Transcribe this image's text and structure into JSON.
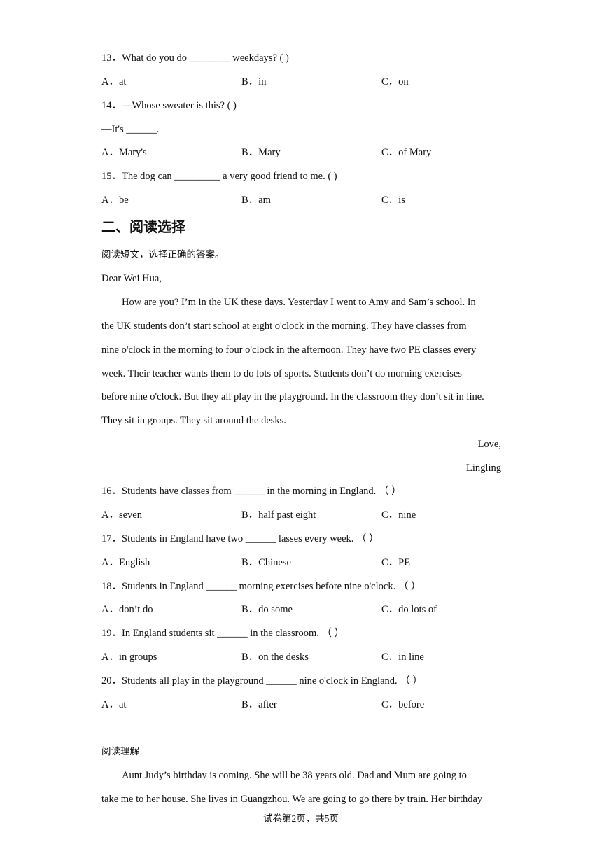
{
  "questions_part1": [
    {
      "number": "13．",
      "prompt": "What do you do ________ weekdays? (    )",
      "options": [
        "A．at",
        "B．in",
        "C．on"
      ]
    },
    {
      "number": "14．",
      "prompt": "—Whose sweater is this? (    )",
      "subline": "—It's ______.",
      "options": [
        "A．Mary's",
        "B．Mary",
        "C．of Mary"
      ]
    },
    {
      "number": "15．",
      "prompt": "The dog can _________ a very good friend to me. (    )",
      "options": [
        "A．be",
        "B．am",
        "C．is"
      ]
    }
  ],
  "section2": {
    "heading": "二、阅读选择",
    "instruction": "阅读短文，选择正确的答案。",
    "letter": {
      "salutation": "Dear Wei Hua,",
      "lines": [
        "How are you? I’m in the UK these days. Yesterday I went to Amy and Sam’s school. In",
        "the UK students don’t start school at eight o'clock in the morning. They have classes from",
        "nine o'clock in the morning to four o'clock in the afternoon. They have two PE classes every",
        "week. Their teacher wants them to do lots of sports. Students don’t do morning exercises",
        "before nine o'clock. But they all play in the playground. In the classroom they don’t sit in line.",
        "They sit in groups. They sit around the desks."
      ],
      "closing": "Love,",
      "signature": "Lingling"
    },
    "questions": [
      {
        "number": "16．",
        "prompt": "Students have classes from ______ in the morning in England. （    ）",
        "options": [
          "A．seven",
          "B．half past eight",
          "C．nine"
        ]
      },
      {
        "number": "17．",
        "prompt": "Students in England have two ______ lasses every week. （    ）",
        "options": [
          "A．English",
          "B．Chinese",
          "C．PE"
        ]
      },
      {
        "number": "18．",
        "prompt": "Students in England ______ morning exercises before nine o'clock. （    ）",
        "options": [
          "A．don’t do",
          "B．do some",
          "C．do lots of"
        ]
      },
      {
        "number": "19．",
        "prompt": "In England students sit ______ in the classroom. （    ）",
        "options": [
          "A．in groups",
          "B．on the desks",
          "C．in line"
        ]
      },
      {
        "number": "20．",
        "prompt": "Students all play in the playground ______ nine o'clock in England. （    ）",
        "options": [
          "A．at",
          "B．after",
          "C．before"
        ]
      }
    ]
  },
  "section3": {
    "title": "阅读理解",
    "lines": [
      "Aunt Judy’s birthday is coming. She will be 38 years old. Dad and Mum are going to",
      "take me to her house. She lives in Guangzhou. We are going to go there by train. Her birthday"
    ]
  },
  "footer": "试卷第2页，共5页"
}
